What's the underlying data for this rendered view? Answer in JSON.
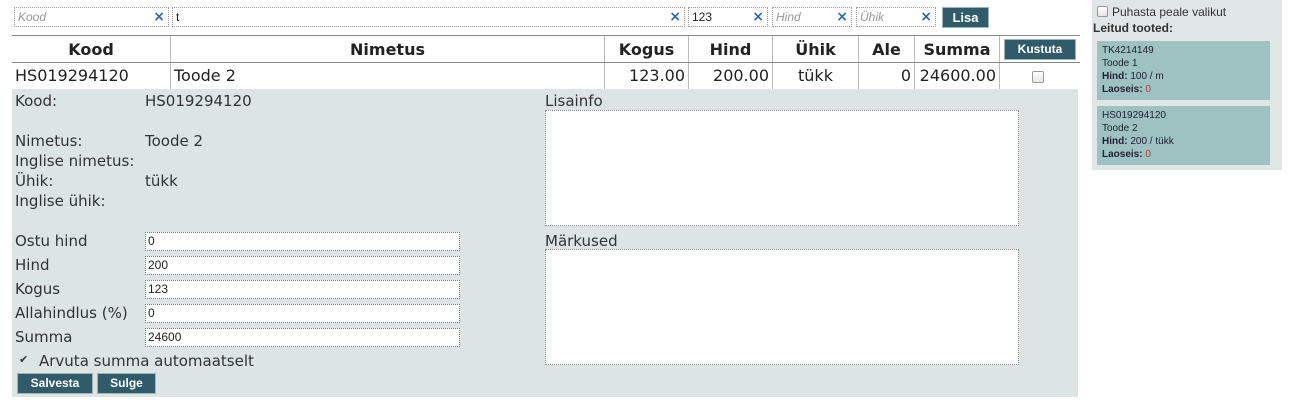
{
  "filters": {
    "kood": {
      "value": "",
      "placeholder": "Kood"
    },
    "nimetus": {
      "value": "t",
      "placeholder": ""
    },
    "kogus": {
      "value": "123",
      "placeholder": ""
    },
    "hind": {
      "value": "",
      "placeholder": "Hind"
    },
    "uhik": {
      "value": "",
      "placeholder": "Ühik"
    },
    "clear_glyph": "×",
    "add_label": "Lisa"
  },
  "table": {
    "headers": {
      "kood": "Kood",
      "nimetus": "Nimetus",
      "kogus": "Kogus",
      "hind": "Hind",
      "uhik": "Ühik",
      "ale": "Ale",
      "summa": "Summa"
    },
    "delete_label": "Kustuta",
    "row": {
      "kood": "HS019294120",
      "nimetus": "Toode 2",
      "kogus": "123.00",
      "hind": "200.00",
      "uhik": "tükk",
      "ale": "0",
      "summa": "24600.00"
    }
  },
  "detail": {
    "kood_label": "Kood:",
    "kood_value": "HS019294120",
    "nimetus_label": "Nimetus:",
    "nimetus_value": "Toode 2",
    "inglise_nimetus_label": "Inglise nimetus:",
    "uhik_label": "Ühik:",
    "uhik_value": "tükk",
    "inglise_uhik_label": "Inglise ühik:",
    "ostu_hind_label": "Ostu hind",
    "ostu_hind_value": "0",
    "hind_label": "Hind",
    "hind_value": "200",
    "kogus_label": "Kogus",
    "kogus_value": "123",
    "allahindlus_label": "Allahindlus (%)",
    "allahindlus_value": "0",
    "summa_label": "Summa",
    "summa_value": "24600",
    "auto_sum_label": "Arvuta summa automaatselt",
    "auto_sum_checked": true,
    "lisainfo_label": "Lisainfo",
    "markused_label": "Märkused",
    "save_label": "Salvesta",
    "close_label": "Sulge"
  },
  "side": {
    "clear_label": "Puhasta peale valikut",
    "title": "Leitud tooted:",
    "products": [
      {
        "code": "TK4214149",
        "name": "Toode 1",
        "price_label": "Hind:",
        "price": "100 / m",
        "stock_label": "Laoseis:",
        "stock": "0"
      },
      {
        "code": "HS019294120",
        "name": "Toode 2",
        "price_label": "Hind:",
        "price": "200 / tükk",
        "stock_label": "Laoseis:",
        "stock": "0"
      }
    ]
  },
  "colors": {
    "accent_button": "#2f5b6b",
    "panel_bg": "#dce5e4",
    "card_bg": "#9dc2c1",
    "clear_icon": "#2b68b4"
  }
}
